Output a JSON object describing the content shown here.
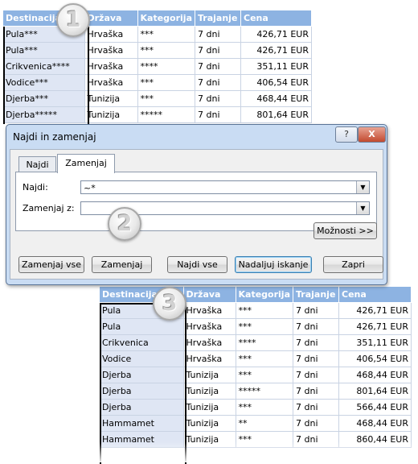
{
  "top_table": {
    "headers": [
      "Destinacija",
      "Država",
      "Kategorija",
      "Trajanje",
      "Cena"
    ],
    "rows": [
      [
        "Pula***",
        "Hrvaška",
        "***",
        "7 dni",
        "426,71 EUR"
      ],
      [
        "Pula***",
        "Hrvaška",
        "***",
        "7 dni",
        "426,71 EUR"
      ],
      [
        "Crikvenica****",
        "Hrvaška",
        "****",
        "7 dni",
        "351,11 EUR"
      ],
      [
        "Vodice***",
        "Hrvaška",
        "***",
        "7 dni",
        "406,54 EUR"
      ],
      [
        "Djerba***",
        "Tunizija",
        "***",
        "7 dni",
        "468,44 EUR"
      ],
      [
        "Djerba*****",
        "Tunizija",
        "*****",
        "7 dni",
        "801,64 EUR"
      ]
    ]
  },
  "dialog": {
    "title": "Najdi in zamenjaj",
    "help_symbol": "?",
    "close_symbol": "X",
    "tabs": [
      "Najdi",
      "Zamenjaj"
    ],
    "active_tab": "Zamenjaj",
    "find_label": "Najdi:",
    "find_value": "~*",
    "replace_label": "Zamenjaj z:",
    "replace_value": "",
    "options_button": "Možnosti >>",
    "buttons": {
      "replace_all": "Zamenjaj vse",
      "replace": "Zamenjaj",
      "find_all": "Najdi vse",
      "find_next": "Nadaljuj iskanje",
      "close": "Zapri"
    }
  },
  "bottom_table": {
    "headers": [
      "Destinacija",
      "Država",
      "Kategorija",
      "Trajanje",
      "Cena"
    ],
    "rows": [
      [
        "Pula",
        "Hrvaška",
        "***",
        "7 dni",
        "426,71 EUR"
      ],
      [
        "Pula",
        "Hrvaška",
        "***",
        "7 dni",
        "426,71 EUR"
      ],
      [
        "Crikvenica",
        "Hrvaška",
        "****",
        "7 dni",
        "351,11 EUR"
      ],
      [
        "Vodice",
        "Hrvaška",
        "***",
        "7 dni",
        "406,54 EUR"
      ],
      [
        "Djerba",
        "Tunizija",
        "***",
        "7 dni",
        "468,44 EUR"
      ],
      [
        "Djerba",
        "Tunizija",
        "*****",
        "7 dni",
        "801,64 EUR"
      ],
      [
        "Djerba",
        "Tunizija",
        "***",
        "7 dni",
        "566,44 EUR"
      ],
      [
        "Hammamet",
        "Tunizija",
        "**",
        "7 dni",
        "468,44 EUR"
      ],
      [
        "Hammamet",
        "Tunizija",
        "***",
        "7 dni",
        "860,44 EUR"
      ]
    ]
  },
  "callouts": [
    "1",
    "2",
    "3"
  ]
}
